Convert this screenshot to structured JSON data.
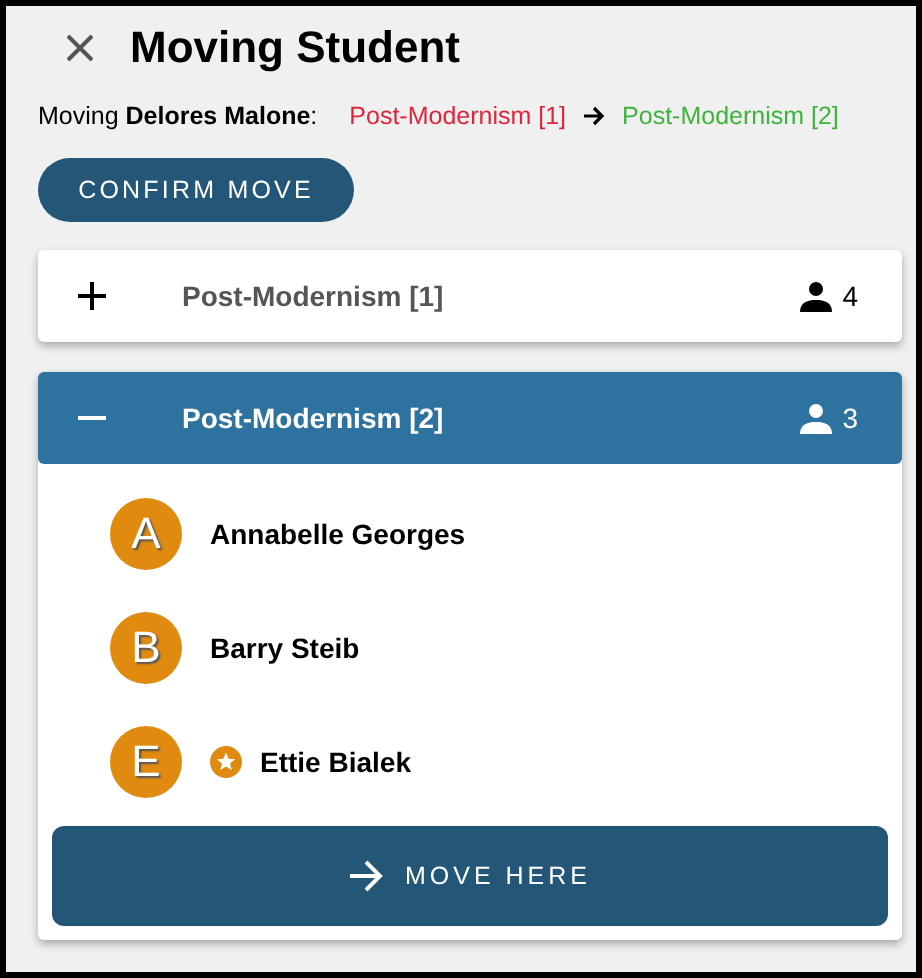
{
  "title": "Moving Student",
  "moving": {
    "text": "Moving **Delores Malone**:",
    "from": "Post-Modernism [1]",
    "to": "Post-Modernism [2]"
  },
  "confirm_button": "CONFIRM MOVE",
  "groups": [
    {
      "name": "Post-Modernism [1]",
      "count": "4",
      "expanded": false
    },
    {
      "name": "Post-Modernism [2]",
      "count": "3",
      "expanded": true,
      "students": [
        {
          "initial": "A",
          "name": "Annabelle Georges",
          "starred": false
        },
        {
          "initial": "B",
          "name": "Barry Steib",
          "starred": false
        },
        {
          "initial": "E",
          "name": "Ettie Bialek",
          "starred": true
        }
      ],
      "move_button": "MOVE HERE"
    }
  ]
}
